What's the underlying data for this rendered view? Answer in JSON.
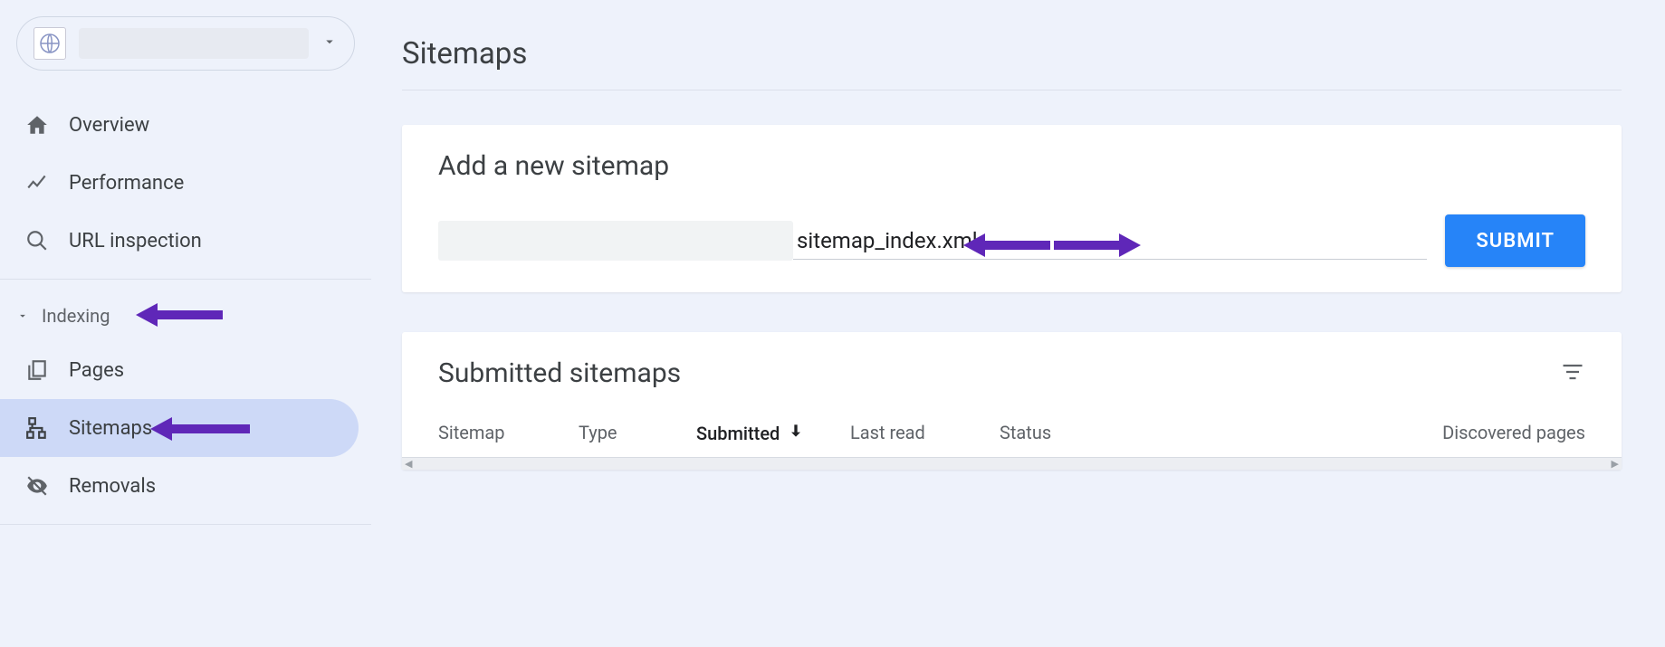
{
  "page": {
    "title": "Sitemaps"
  },
  "sidebar": {
    "items": {
      "overview": "Overview",
      "performance": "Performance",
      "url_inspection": "URL inspection"
    },
    "section_indexing": "Indexing",
    "indexing": {
      "pages": "Pages",
      "sitemaps": "Sitemaps",
      "removals": "Removals"
    }
  },
  "add_card": {
    "heading": "Add a new sitemap",
    "input_value": "sitemap_index.xml",
    "submit_label": "SUBMIT"
  },
  "list_card": {
    "heading": "Submitted sitemaps",
    "columns": {
      "sitemap": "Sitemap",
      "type": "Type",
      "submitted": "Submitted",
      "lastread": "Last read",
      "status": "Status",
      "pages": "Discovered pages"
    }
  }
}
